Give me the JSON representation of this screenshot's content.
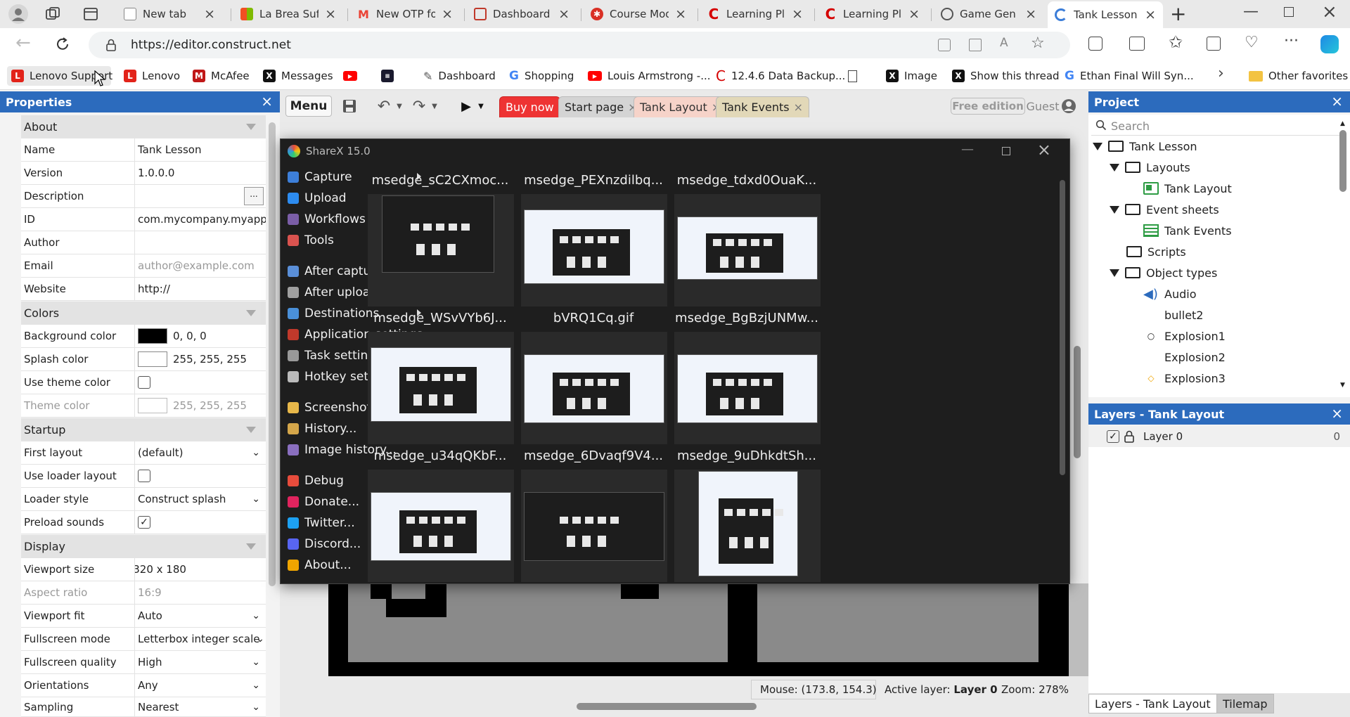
{
  "browser": {
    "tabs": [
      {
        "label": "New tab",
        "color": "#888"
      },
      {
        "label": "La Brea Suffe",
        "color": "#f25022"
      },
      {
        "label": "New OTP for",
        "color": "#ea4335"
      },
      {
        "label": "Dashboard -",
        "color": "#c0392b"
      },
      {
        "label": "Course Mod",
        "color": "#d93025"
      },
      {
        "label": "Learning Plat",
        "color": "#d50000"
      },
      {
        "label": "Learning Plat",
        "color": "#d50000"
      },
      {
        "label": "Game Gen C",
        "color": "#555"
      },
      {
        "label": "Tank Lesson",
        "color": "#3b7dd8"
      }
    ],
    "url": "https://editor.construct.net",
    "bookmarks": [
      "Lenovo Support",
      "Lenovo",
      "McAfee",
      "Messages",
      "",
      "",
      "Dashboard",
      "Shopping",
      "Louis Armstrong -...",
      "12.4.6 Data Backup...",
      "",
      "Image",
      "Show this thread",
      "Ethan Final Will Syn..."
    ],
    "other_favorites": "Other favorites"
  },
  "properties": {
    "title": "Properties",
    "about": "About",
    "rows_about": [
      {
        "k": "Name",
        "v": "Tank Lesson"
      },
      {
        "k": "Version",
        "v": "1.0.0.0"
      },
      {
        "k": "Description",
        "v": ""
      },
      {
        "k": "ID",
        "v": "com.mycompany.myapp"
      },
      {
        "k": "Author",
        "v": ""
      },
      {
        "k": "Email",
        "v": "author@example.com"
      },
      {
        "k": "Website",
        "v": "http://"
      }
    ],
    "colors": "Colors",
    "bg_color": {
      "k": "Background color",
      "v": "0, 0, 0"
    },
    "splash_color": {
      "k": "Splash color",
      "v": "255, 255, 255"
    },
    "use_theme": "Use theme color",
    "theme_color": {
      "k": "Theme color",
      "v": "255, 255, 255"
    },
    "startup": "Startup",
    "first_layout": {
      "k": "First layout",
      "v": "(default)"
    },
    "use_loader": "Use loader layout",
    "loader_style": {
      "k": "Loader style",
      "v": "Construct splash"
    },
    "preload": "Preload sounds",
    "display": "Display",
    "viewport_size": {
      "k": "Viewport size",
      "v": "320 x 180"
    },
    "aspect": {
      "k": "Aspect ratio",
      "v": "16:9"
    },
    "viewport_fit": {
      "k": "Viewport fit",
      "v": "Auto"
    },
    "fullscreen_mode": {
      "k": "Fullscreen mode",
      "v": "Letterbox integer scale"
    },
    "fullscreen_quality": {
      "k": "Fullscreen quality",
      "v": "High"
    },
    "orientations": {
      "k": "Orientations",
      "v": "Any"
    },
    "sampling": {
      "k": "Sampling",
      "v": "Nearest"
    }
  },
  "toolbar": {
    "menu": "Menu",
    "buy": "Buy now",
    "start": "Start page",
    "tank_layout": "Tank Layout",
    "tank_events": "Tank Events",
    "free": "Free edition",
    "guest": "Guest"
  },
  "project": {
    "title": "Project",
    "search": "Search",
    "root": "Tank Lesson",
    "layouts": "Layouts",
    "tank_layout": "Tank Layout",
    "event_sheets": "Event sheets",
    "tank_events": "Tank Events",
    "scripts": "Scripts",
    "object_types": "Object types",
    "objects": [
      "Audio",
      "bullet2",
      "Explosion1",
      "Explosion2",
      "Explosion3"
    ]
  },
  "layers": {
    "title": "Layers - Tank Layout",
    "layer": "Layer 0",
    "count": "0"
  },
  "bottom_tabs": {
    "layers": "Layers - Tank Layout",
    "tilemap": "Tilemap"
  },
  "status": {
    "mouse": "Mouse: (173.8, 154.3)",
    "active_label": "Active layer:",
    "active_value": "Layer 0",
    "zoom": "Zoom: 278%"
  },
  "sharex": {
    "title": "ShareX 15.0",
    "menu": [
      {
        "label": "Capture",
        "arrow": true,
        "color": "#3d7fd9"
      },
      {
        "label": "Upload",
        "arrow": true,
        "color": "#2d8cf0"
      },
      {
        "label": "Workflows",
        "arrow": true,
        "color": "#7b5ea7"
      },
      {
        "label": "Tools",
        "arrow": true,
        "color": "#d9534f"
      },
      {
        "label": "After capture tasks",
        "arrow": true,
        "color": "#5a8fd8"
      },
      {
        "label": "After upload tasks",
        "arrow": true,
        "color": "#a0a0a0"
      },
      {
        "label": "Destinations",
        "arrow": true,
        "color": "#4a90d9"
      },
      {
        "label": "Application settings...",
        "arrow": false,
        "color": "#c0392b"
      },
      {
        "label": "Task settings...",
        "arrow": false,
        "color": "#999999"
      },
      {
        "label": "Hotkey settings...",
        "arrow": false,
        "color": "#bbbbbb"
      },
      {
        "label": "Screenshots folder...",
        "arrow": false,
        "color": "#e8b84a"
      },
      {
        "label": "History...",
        "arrow": false,
        "color": "#d4a64a"
      },
      {
        "label": "Image history...",
        "arrow": false,
        "color": "#8a6fbf"
      },
      {
        "label": "Debug",
        "arrow": true,
        "color": "#e74c3c"
      },
      {
        "label": "Donate...",
        "arrow": false,
        "color": "#e0245e"
      },
      {
        "label": "Twitter...",
        "arrow": false,
        "color": "#1da1f2"
      },
      {
        "label": "Discord...",
        "arrow": false,
        "color": "#5865f2"
      },
      {
        "label": "About...",
        "arrow": false,
        "color": "#f0a500"
      }
    ],
    "thumbs": [
      "msedge_sC2CXmoc...",
      "msedge_PEXnzdilbq...",
      "msedge_tdxd0OuaK...",
      "msedge_WSvVYb6J...",
      "bVRQ1Cq.gif",
      "msedge_BgBzjUNMw...",
      "msedge_u34qQKbF...",
      "msedge_6Dvaqf9V4...",
      "msedge_9uDhkdtSh..."
    ]
  }
}
